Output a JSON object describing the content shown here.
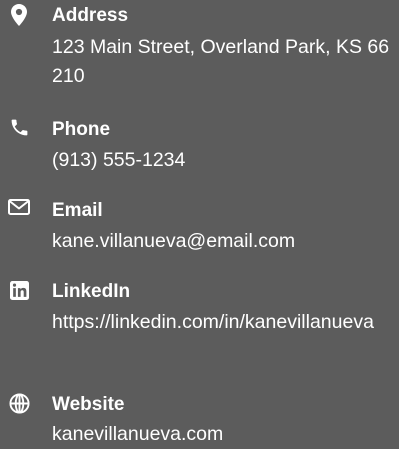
{
  "contacts": {
    "address": {
      "label": "Address",
      "value": "123 Main Street, Overland Park, KS 66210",
      "icon": "map-marker-icon"
    },
    "phone": {
      "label": "Phone",
      "value": "(913) 555-1234",
      "icon": "phone-icon"
    },
    "email": {
      "label": "Email",
      "value": "kane.villanueva@email.com",
      "icon": "envelope-icon"
    },
    "linkedin": {
      "label": "LinkedIn",
      "value": "https://linkedin.com/in/kanevillanueva",
      "icon": "linkedin-icon"
    },
    "website": {
      "label": "Website",
      "value": "kanevillanueva.com",
      "icon": "globe-icon"
    }
  },
  "colors": {
    "background": "#5c5c5c",
    "text": "#ffffff"
  }
}
